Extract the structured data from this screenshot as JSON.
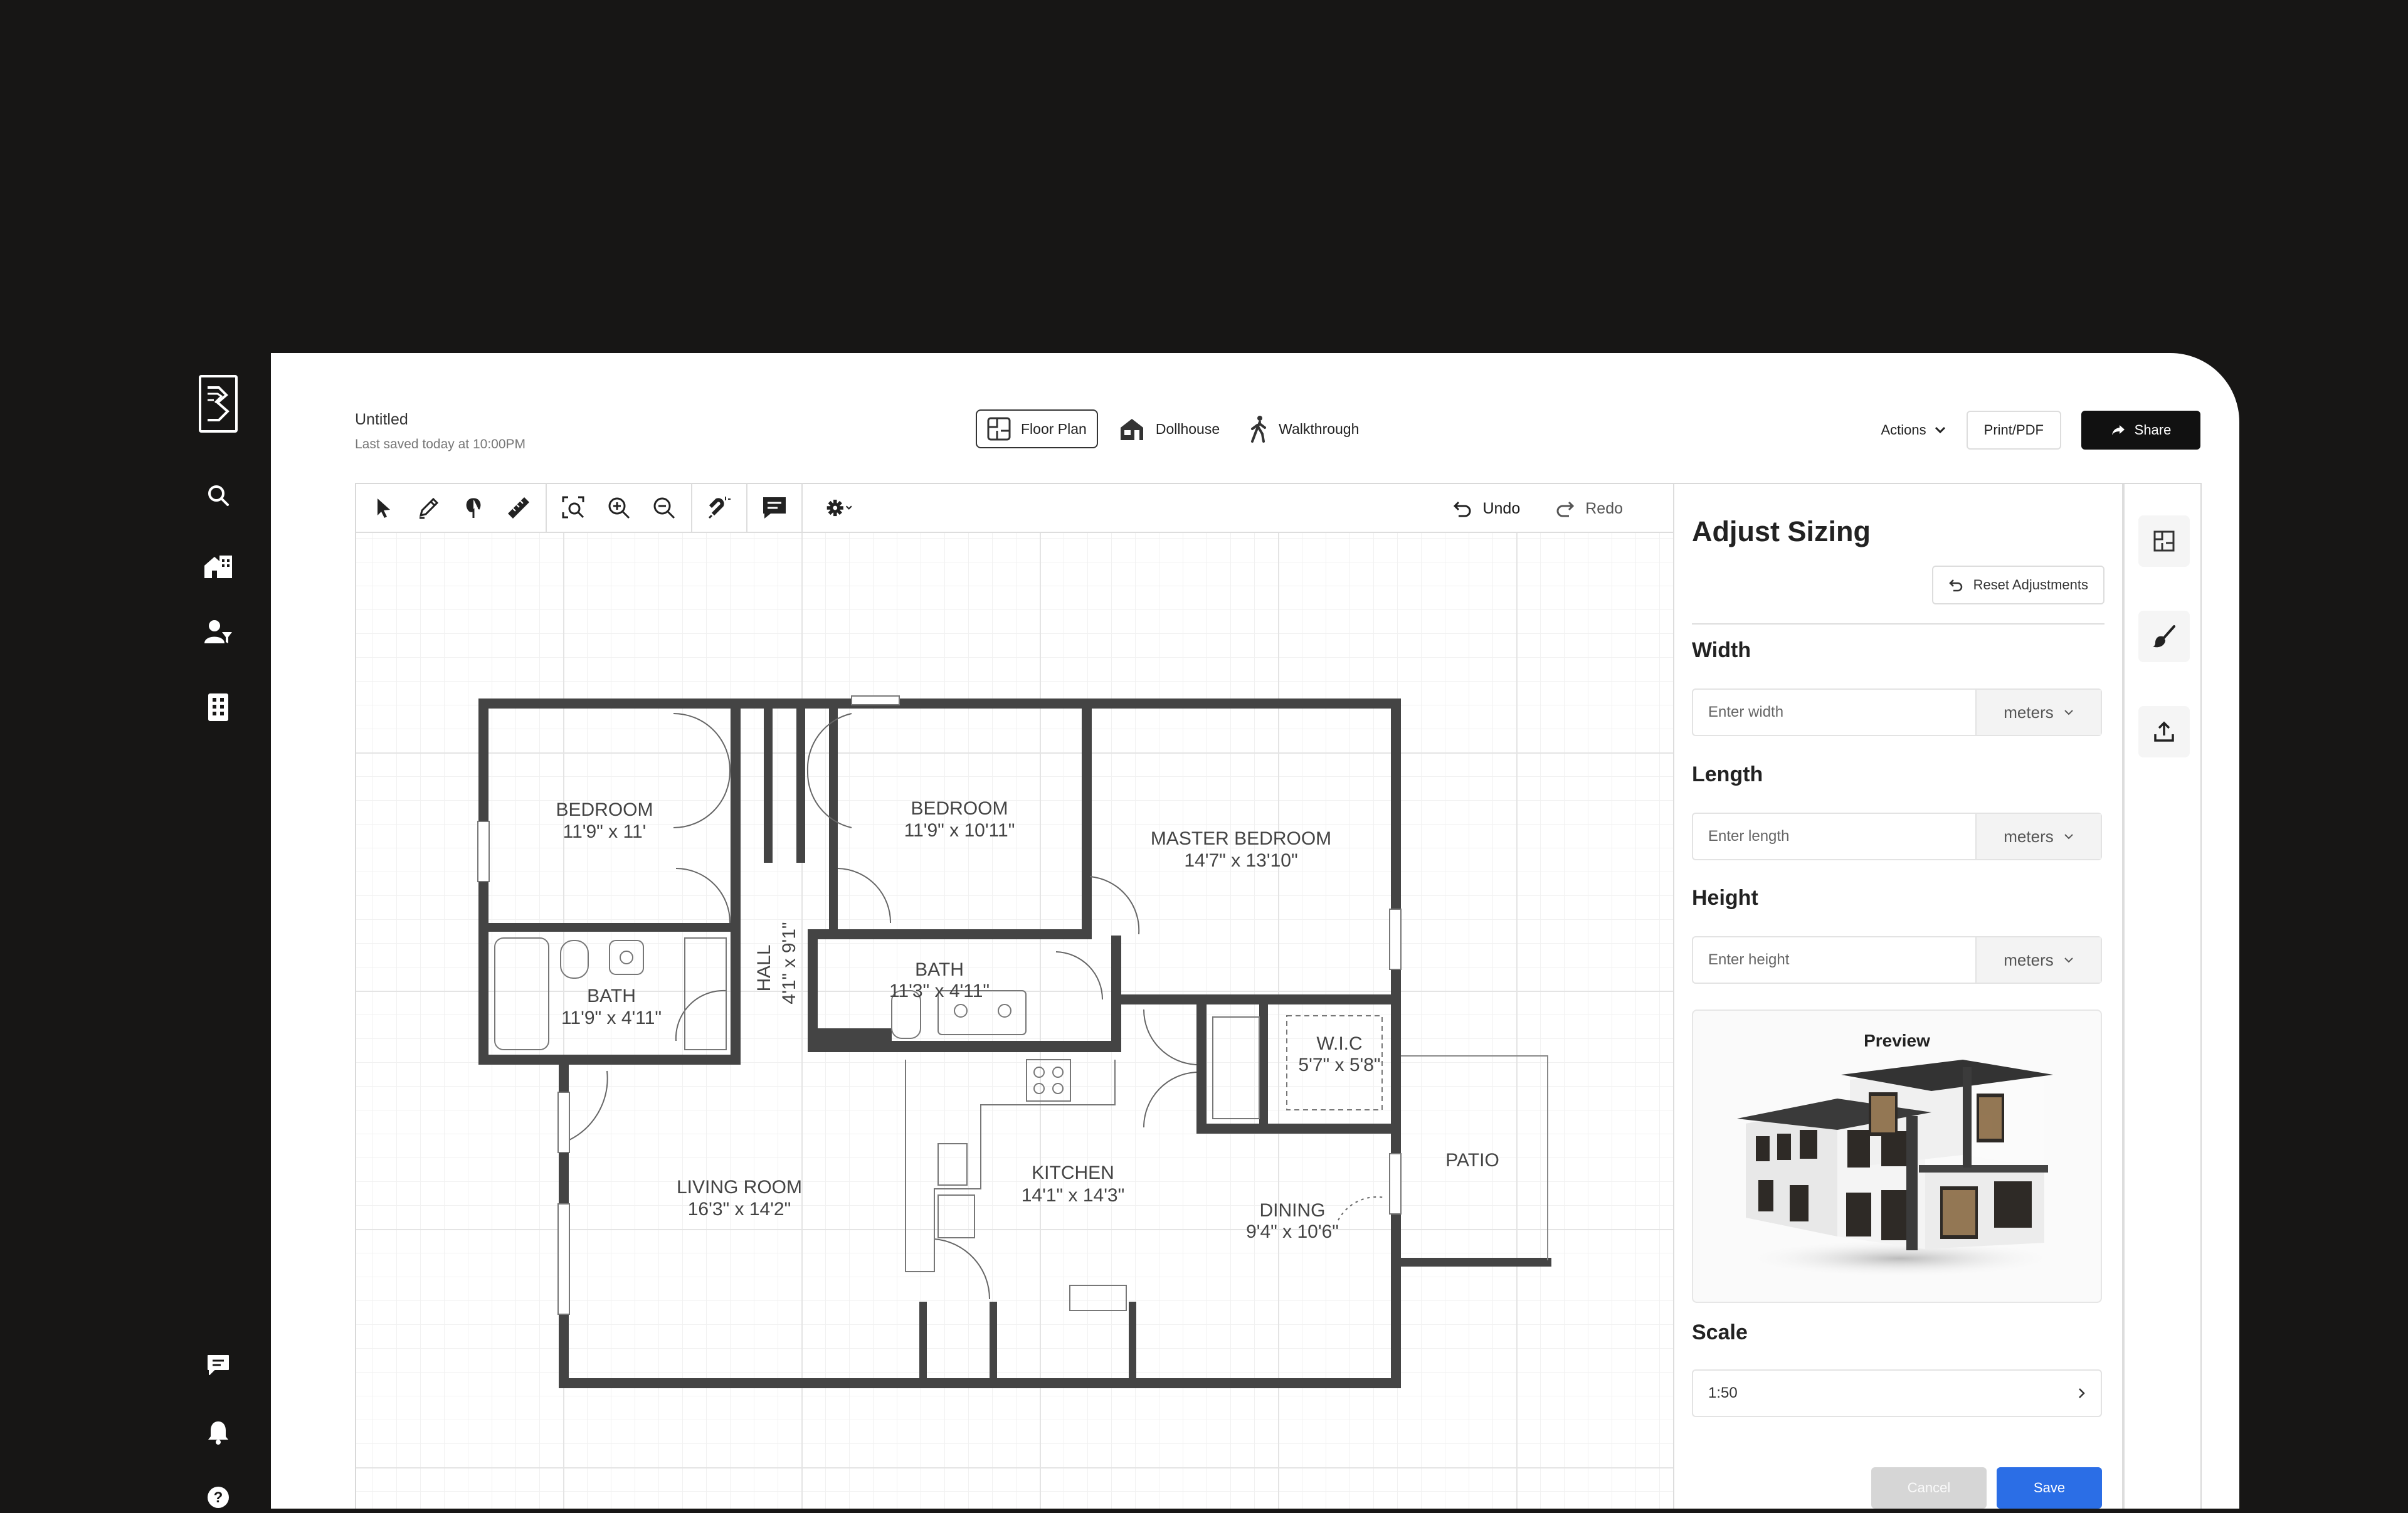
{
  "document": {
    "title": "Untitled",
    "last_saved": "Last saved today at 10:00PM"
  },
  "view_tabs": [
    {
      "label": "Floor Plan",
      "icon": "floor-plan-icon",
      "active": true
    },
    {
      "label": "Dollhouse",
      "icon": "house-icon",
      "active": false
    },
    {
      "label": "Walkthrough",
      "icon": "walking-person-icon",
      "active": false
    }
  ],
  "top_actions": {
    "actions_label": "Actions",
    "print_label": "Print/PDF",
    "share_label": "Share"
  },
  "toolbar": {
    "undo_label": "Undo",
    "redo_label": "Redo"
  },
  "floor_plan": {
    "rooms": [
      {
        "name": "BEDROOM",
        "size": "11'9\" x 11'"
      },
      {
        "name": "BEDROOM",
        "size": "11'9\" x 10'11\""
      },
      {
        "name": "MASTER BEDROOM",
        "size": "14'7\" x 13'10\""
      },
      {
        "name": "HALL",
        "size": "4'1\" x 9'1\""
      },
      {
        "name": "BATH",
        "size": "11'9\" x 4'11\""
      },
      {
        "name": "BATH",
        "size": "11'3\" x 4'11\""
      },
      {
        "name": "W.I.C",
        "size": "5'7\" x 5'8\""
      },
      {
        "name": "PATIO",
        "size": ""
      },
      {
        "name": "LIVING ROOM",
        "size": "16'3\" x 14'2\""
      },
      {
        "name": "KITCHEN",
        "size": "14'1\" x 14'3\""
      },
      {
        "name": "DINING",
        "size": "9'4\" x 10'6\""
      }
    ]
  },
  "panel": {
    "title": "Adjust Sizing",
    "reset_label": "Reset Adjustments",
    "width": {
      "label": "Width",
      "placeholder": "Enter width",
      "unit": "meters"
    },
    "length": {
      "label": "Length",
      "placeholder": "Enter length",
      "unit": "meters"
    },
    "height": {
      "label": "Height",
      "placeholder": "Enter height",
      "unit": "meters"
    },
    "preview_label": "Preview",
    "scale": {
      "label": "Scale",
      "value": "1:50"
    },
    "cancel_label": "Cancel",
    "save_label": "Save"
  },
  "colors": {
    "accent": "#2b6ee6",
    "dark": "#111111",
    "sidebar": "#171615"
  }
}
